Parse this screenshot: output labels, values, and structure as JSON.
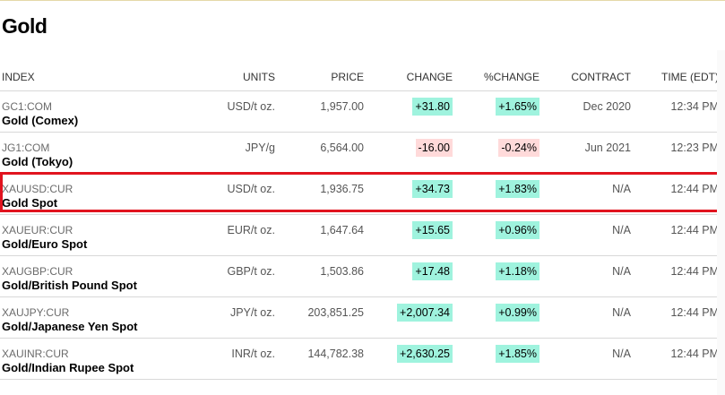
{
  "page": {
    "title": "Gold"
  },
  "columns": {
    "index": "INDEX",
    "units": "UNITS",
    "price": "PRICE",
    "change": "CHANGE",
    "pct_change": "%CHANGE",
    "contract": "CONTRACT",
    "time": "TIME (EDT)"
  },
  "rows": [
    {
      "symbol": "GC1:COM",
      "name": "Gold (Comex)",
      "units": "USD/t oz.",
      "price": "1,957.00",
      "change": "+31.80",
      "pct_change": "+1.65%",
      "contract": "Dec 2020",
      "time": "12:34 PM",
      "direction": "up"
    },
    {
      "symbol": "JG1:COM",
      "name": "Gold (Tokyo)",
      "units": "JPY/g",
      "price": "6,564.00",
      "change": "-16.00",
      "pct_change": "-0.24%",
      "contract": "Jun 2021",
      "time": "12:23 PM",
      "direction": "down"
    },
    {
      "symbol": "XAUUSD:CUR",
      "name": "Gold Spot",
      "units": "USD/t oz.",
      "price": "1,936.75",
      "change": "+34.73",
      "pct_change": "+1.83%",
      "contract": "N/A",
      "time": "12:44 PM",
      "direction": "up",
      "highlighted": true
    },
    {
      "symbol": "XAUEUR:CUR",
      "name": "Gold/Euro Spot",
      "units": "EUR/t oz.",
      "price": "1,647.64",
      "change": "+15.65",
      "pct_change": "+0.96%",
      "contract": "N/A",
      "time": "12:44 PM",
      "direction": "up"
    },
    {
      "symbol": "XAUGBP:CUR",
      "name": "Gold/British Pound Spot",
      "units": "GBP/t oz.",
      "price": "1,503.86",
      "change": "+17.48",
      "pct_change": "+1.18%",
      "contract": "N/A",
      "time": "12:44 PM",
      "direction": "up"
    },
    {
      "symbol": "XAUJPY:CUR",
      "name": "Gold/Japanese Yen Spot",
      "units": "JPY/t oz.",
      "price": "203,851.25",
      "change": "+2,007.34",
      "pct_change": "+0.99%",
      "contract": "N/A",
      "time": "12:44 PM",
      "direction": "up"
    },
    {
      "symbol": "XAUINR:CUR",
      "name": "Gold/Indian Rupee Spot",
      "units": "INR/t oz.",
      "price": "144,782.38",
      "change": "+2,630.25",
      "pct_change": "+1.85%",
      "contract": "N/A",
      "time": "12:44 PM",
      "direction": "up"
    }
  ],
  "colors": {
    "positive_bg": "#9ff3de",
    "negative_bg": "#ffdada",
    "highlight_border": "#e1141f"
  }
}
